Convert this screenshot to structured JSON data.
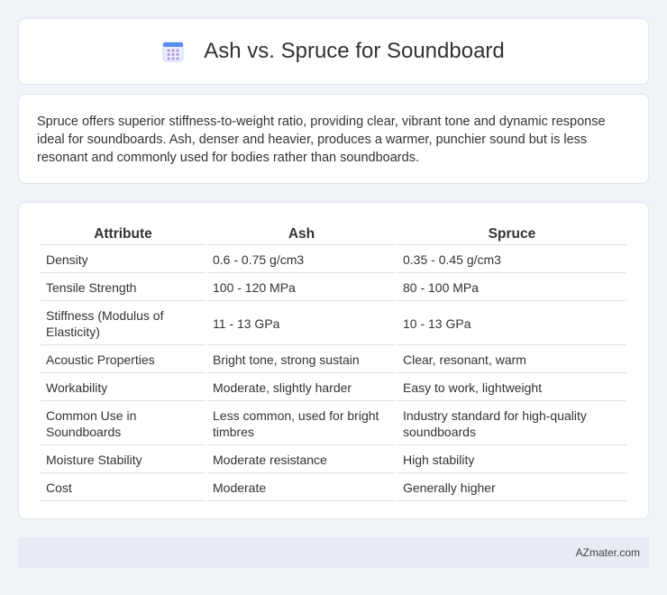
{
  "header": {
    "title": "Ash vs. Spruce for Soundboard",
    "icon": "calendar-icon"
  },
  "intro": {
    "text": "Spruce offers superior stiffness-to-weight ratio, providing clear, vibrant tone and dynamic response ideal for soundboards. Ash, denser and heavier, produces a warmer, punchier sound but is less resonant and commonly used for bodies rather than soundboards."
  },
  "table": {
    "columns": [
      "Attribute",
      "Ash",
      "Spruce"
    ],
    "rows": [
      [
        "Density",
        "0.6 - 0.75 g/cm3",
        "0.35 - 0.45 g/cm3"
      ],
      [
        "Tensile Strength",
        "100 - 120 MPa",
        "80 - 100 MPa"
      ],
      [
        "Stiffness (Modulus of Elasticity)",
        "11 - 13 GPa",
        "10 - 13 GPa"
      ],
      [
        "Acoustic Properties",
        "Bright tone, strong sustain",
        "Clear, resonant, warm"
      ],
      [
        "Workability",
        "Moderate, slightly harder",
        "Easy to work, lightweight"
      ],
      [
        "Common Use in Soundboards",
        "Less common, used for bright timbres",
        "Industry standard for high-quality soundboards"
      ],
      [
        "Moisture Stability",
        "Moderate resistance",
        "High stability"
      ],
      [
        "Cost",
        "Moderate",
        "Generally higher"
      ]
    ]
  },
  "footer": {
    "brand": "AZmater.com"
  },
  "colors": {
    "background": "#f1f4f9",
    "card": "#ffffff",
    "footer": "#e6ebf4",
    "icon_accent": "#5b8def"
  }
}
